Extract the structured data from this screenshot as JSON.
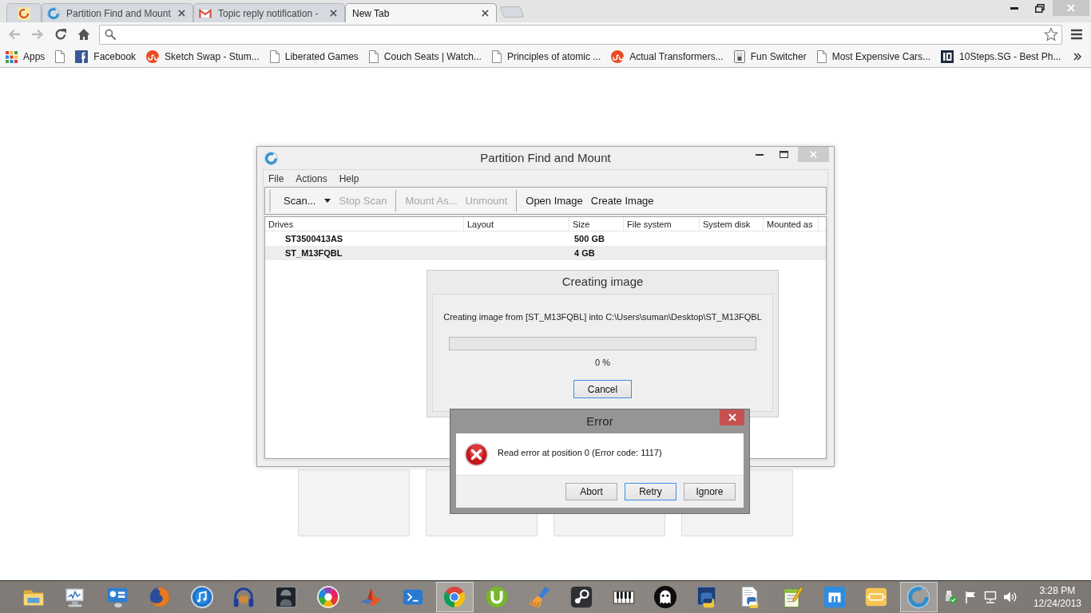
{
  "browser": {
    "tabs": [
      {
        "kind": "pinned",
        "selected": false
      },
      {
        "kind": "app",
        "title": "Partition Find and Mount",
        "selected": false
      },
      {
        "kind": "mail",
        "title": "Topic reply notification -",
        "selected": false
      },
      {
        "kind": "blank",
        "title": "New Tab",
        "selected": true
      }
    ],
    "nav_buttons": [
      {
        "kind": "back",
        "disabled": true
      },
      {
        "kind": "forward",
        "disabled": true
      },
      {
        "kind": "reload",
        "disabled": false
      },
      {
        "kind": "home",
        "disabled": false
      }
    ],
    "bookmarks": [
      {
        "kind": "grid",
        "label": "Apps"
      },
      {
        "kind": "page"
      },
      {
        "kind": "social",
        "label": "Facebook"
      },
      {
        "kind": "swirl",
        "label": "Sketch Swap - Stum..."
      },
      {
        "kind": "page",
        "label": "Liberated Games"
      },
      {
        "kind": "page",
        "label": "Couch Seats | Watch..."
      },
      {
        "kind": "page",
        "label": "Principles of atomic ..."
      },
      {
        "kind": "swirl",
        "label": "Actual Transformers..."
      },
      {
        "kind": "switch",
        "label": "Fun Switcher"
      },
      {
        "kind": "page",
        "label": "Most Expensive Cars..."
      },
      {
        "kind": "bars",
        "label": "10Steps.SG - Best Ph..."
      }
    ]
  },
  "app_window": {
    "title": "Partition Find and Mount",
    "menu": [
      "File",
      "Actions",
      "Help"
    ],
    "toolbar": [
      {
        "kind": "dropdown",
        "label": "Scan...",
        "disabled": false
      },
      {
        "kind": "button",
        "label": "Stop Scan",
        "disabled": true
      },
      {
        "kind": "separator"
      },
      {
        "kind": "button",
        "label": "Mount As...",
        "disabled": true
      },
      {
        "kind": "button",
        "label": "Unmount",
        "disabled": true
      },
      {
        "kind": "separator"
      },
      {
        "kind": "button",
        "label": "Open Image",
        "disabled": false
      },
      {
        "kind": "button",
        "label": "Create Image",
        "disabled": false
      }
    ],
    "table": {
      "columns": [
        "Drives",
        "Layout",
        "Size",
        "File system",
        "System disk",
        "Mounted as"
      ],
      "rows": [
        {
          "drive": "ST3500413AS",
          "size": "500 GB",
          "selected": false
        },
        {
          "drive": "ST_M13FQBL",
          "size": "4 GB",
          "selected": true
        }
      ]
    }
  },
  "progress_dialog": {
    "title": "Creating image",
    "message": "Creating image from [ST_M13FQBL] into C:\\Users\\suman\\Desktop\\ST_M13FQBL",
    "level": 0,
    "reading": "0 %",
    "buttons": [
      {
        "label": "Cancel",
        "focused": true
      }
    ]
  },
  "error_dialog": {
    "title": "Error",
    "message": "Read error at position 0 (Error code: 1117)",
    "buttons": [
      {
        "label": "Abort",
        "focused": false
      },
      {
        "label": "Retry",
        "focused": true
      },
      {
        "label": "Ignore",
        "focused": false
      }
    ]
  },
  "taskbar": {
    "buttons": [
      {
        "active": false
      },
      {
        "active": false
      },
      {
        "active": false
      },
      {
        "active": false
      },
      {
        "active": false
      },
      {
        "active": false
      },
      {
        "active": false
      },
      {
        "active": false
      },
      {
        "active": false
      },
      {
        "active": false
      },
      {
        "active": true
      },
      {
        "active": false
      },
      {
        "active": false
      },
      {
        "active": false
      },
      {
        "active": false
      },
      {
        "active": false
      },
      {
        "active": false
      },
      {
        "active": false
      },
      {
        "active": false
      },
      {
        "active": false
      },
      {
        "active": false
      },
      {
        "active": true
      }
    ],
    "clock": {
      "time": "3:28 PM",
      "date": "12/24/2013"
    }
  }
}
